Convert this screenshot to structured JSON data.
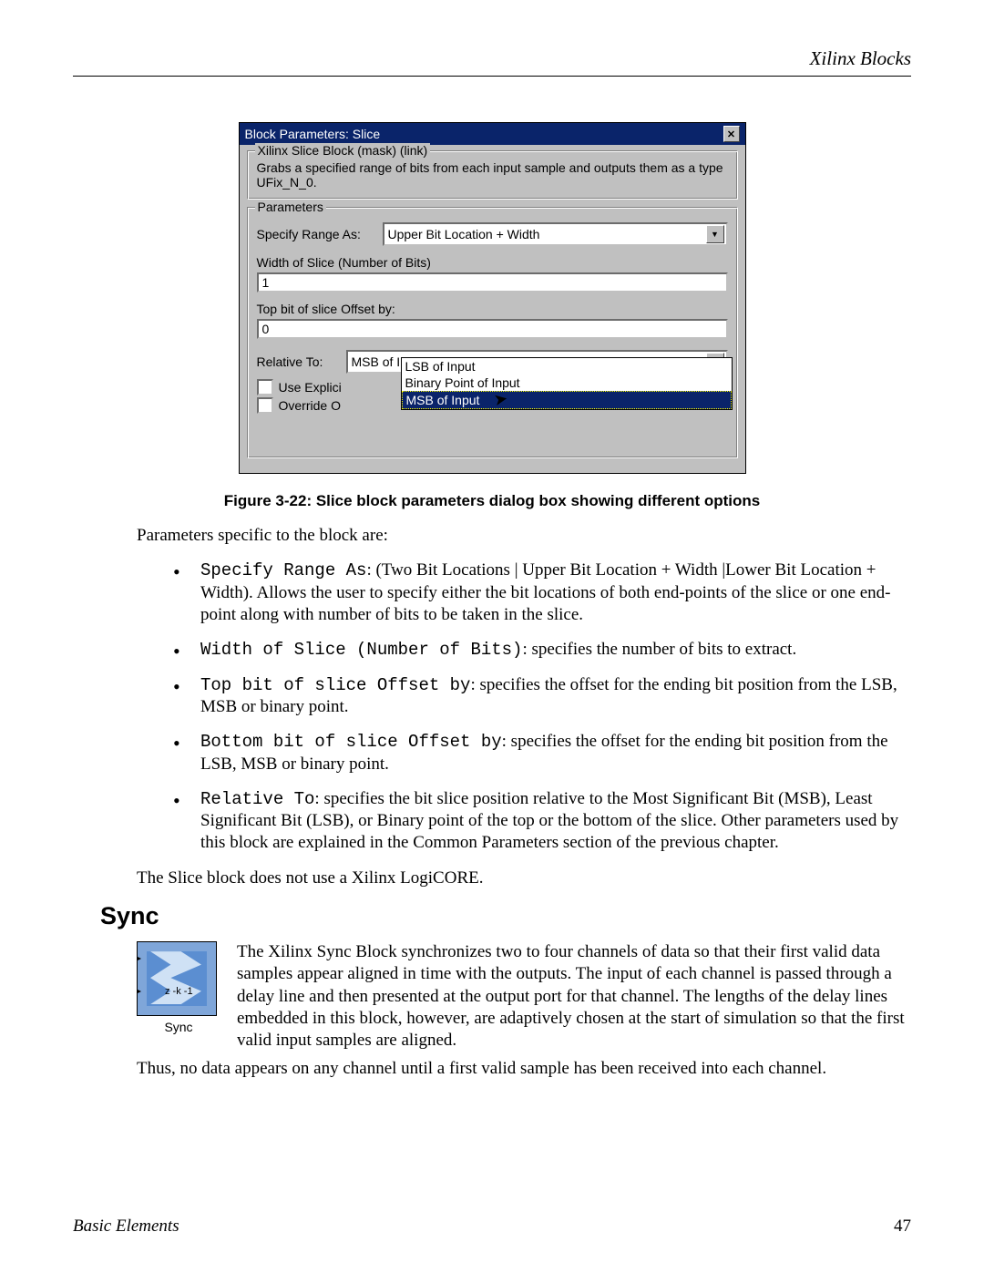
{
  "header": {
    "right": "Xilinx Blocks"
  },
  "dialog": {
    "title": "Block Parameters: Slice",
    "mask_legend": "Xilinx Slice Block (mask) (link)",
    "mask_desc": "Grabs a specified range of bits from each input sample and outputs them as a type UFix_N_0.",
    "params_legend": "Parameters",
    "specify_label": "Specify Range As:",
    "specify_value": "Upper Bit Location + Width",
    "width_label": "Width of Slice (Number of Bits)",
    "width_value": "1",
    "top_label": "Top bit of slice Offset by:",
    "top_value": "0",
    "relative_label": "Relative To:",
    "relative_value": "MSB of Input",
    "dropdown_options": {
      "opt1": "LSB of Input",
      "opt2": "Binary Point of Input",
      "opt3": "MSB of Input"
    },
    "checkbox_explicit": "Use Explici",
    "checkbox_override": "Override O"
  },
  "figure_caption": "Figure 3-22:   Slice block parameters dialog box showing different options",
  "intro": "Parameters specific to the block are:",
  "bullets": {
    "b1_code": "Specify Range As",
    "b1_text": ": (Two Bit Locations | Upper Bit Location + Width |Lower Bit Location + Width).  Allows the user to specify either the bit locations of both end-points of the slice or one end-point along with number of bits to be taken in the slice.",
    "b2_code": "Width of Slice (Number of Bits)",
    "b2_text": ": specifies the number of bits to extract.",
    "b3_code": "Top bit of slice Offset by",
    "b3_text": ": specifies the offset for the ending bit position from the LSB, MSB or binary point.",
    "b4_code": "Bottom bit of slice Offset by",
    "b4_text": ": specifies the offset for the ending bit position from the LSB, MSB or binary point.",
    "b5_code": "Relative To",
    "b5_text": ": specifies the bit slice position relative to the Most Significant Bit (MSB), Least Significant Bit (LSB), or Binary point of the top or the bottom of the slice. Other parameters used by this block are explained in the Common Parameters section of the previous chapter."
  },
  "after_bullets": "The Slice block does not use a Xilinx LogiCORE.",
  "section_sync": "Sync",
  "sync_icon": {
    "caption": "Sync",
    "z_label": "z -k -1"
  },
  "sync_para_1": "The Xilinx Sync Block synchronizes two to four channels of data so that their first valid data samples appear aligned in time with the outputs. The input of each channel is passed through a delay line and then presented at the output port for that channel. The lengths of the delay lines embedded in this block, however, are adaptively chosen at the start of simulation so that the first valid input samples are aligned.",
  "sync_para_2": "Thus, no data appears on any channel until a first valid sample has been received into each channel.",
  "footer": {
    "left": "Basic Elements",
    "page": "47"
  }
}
